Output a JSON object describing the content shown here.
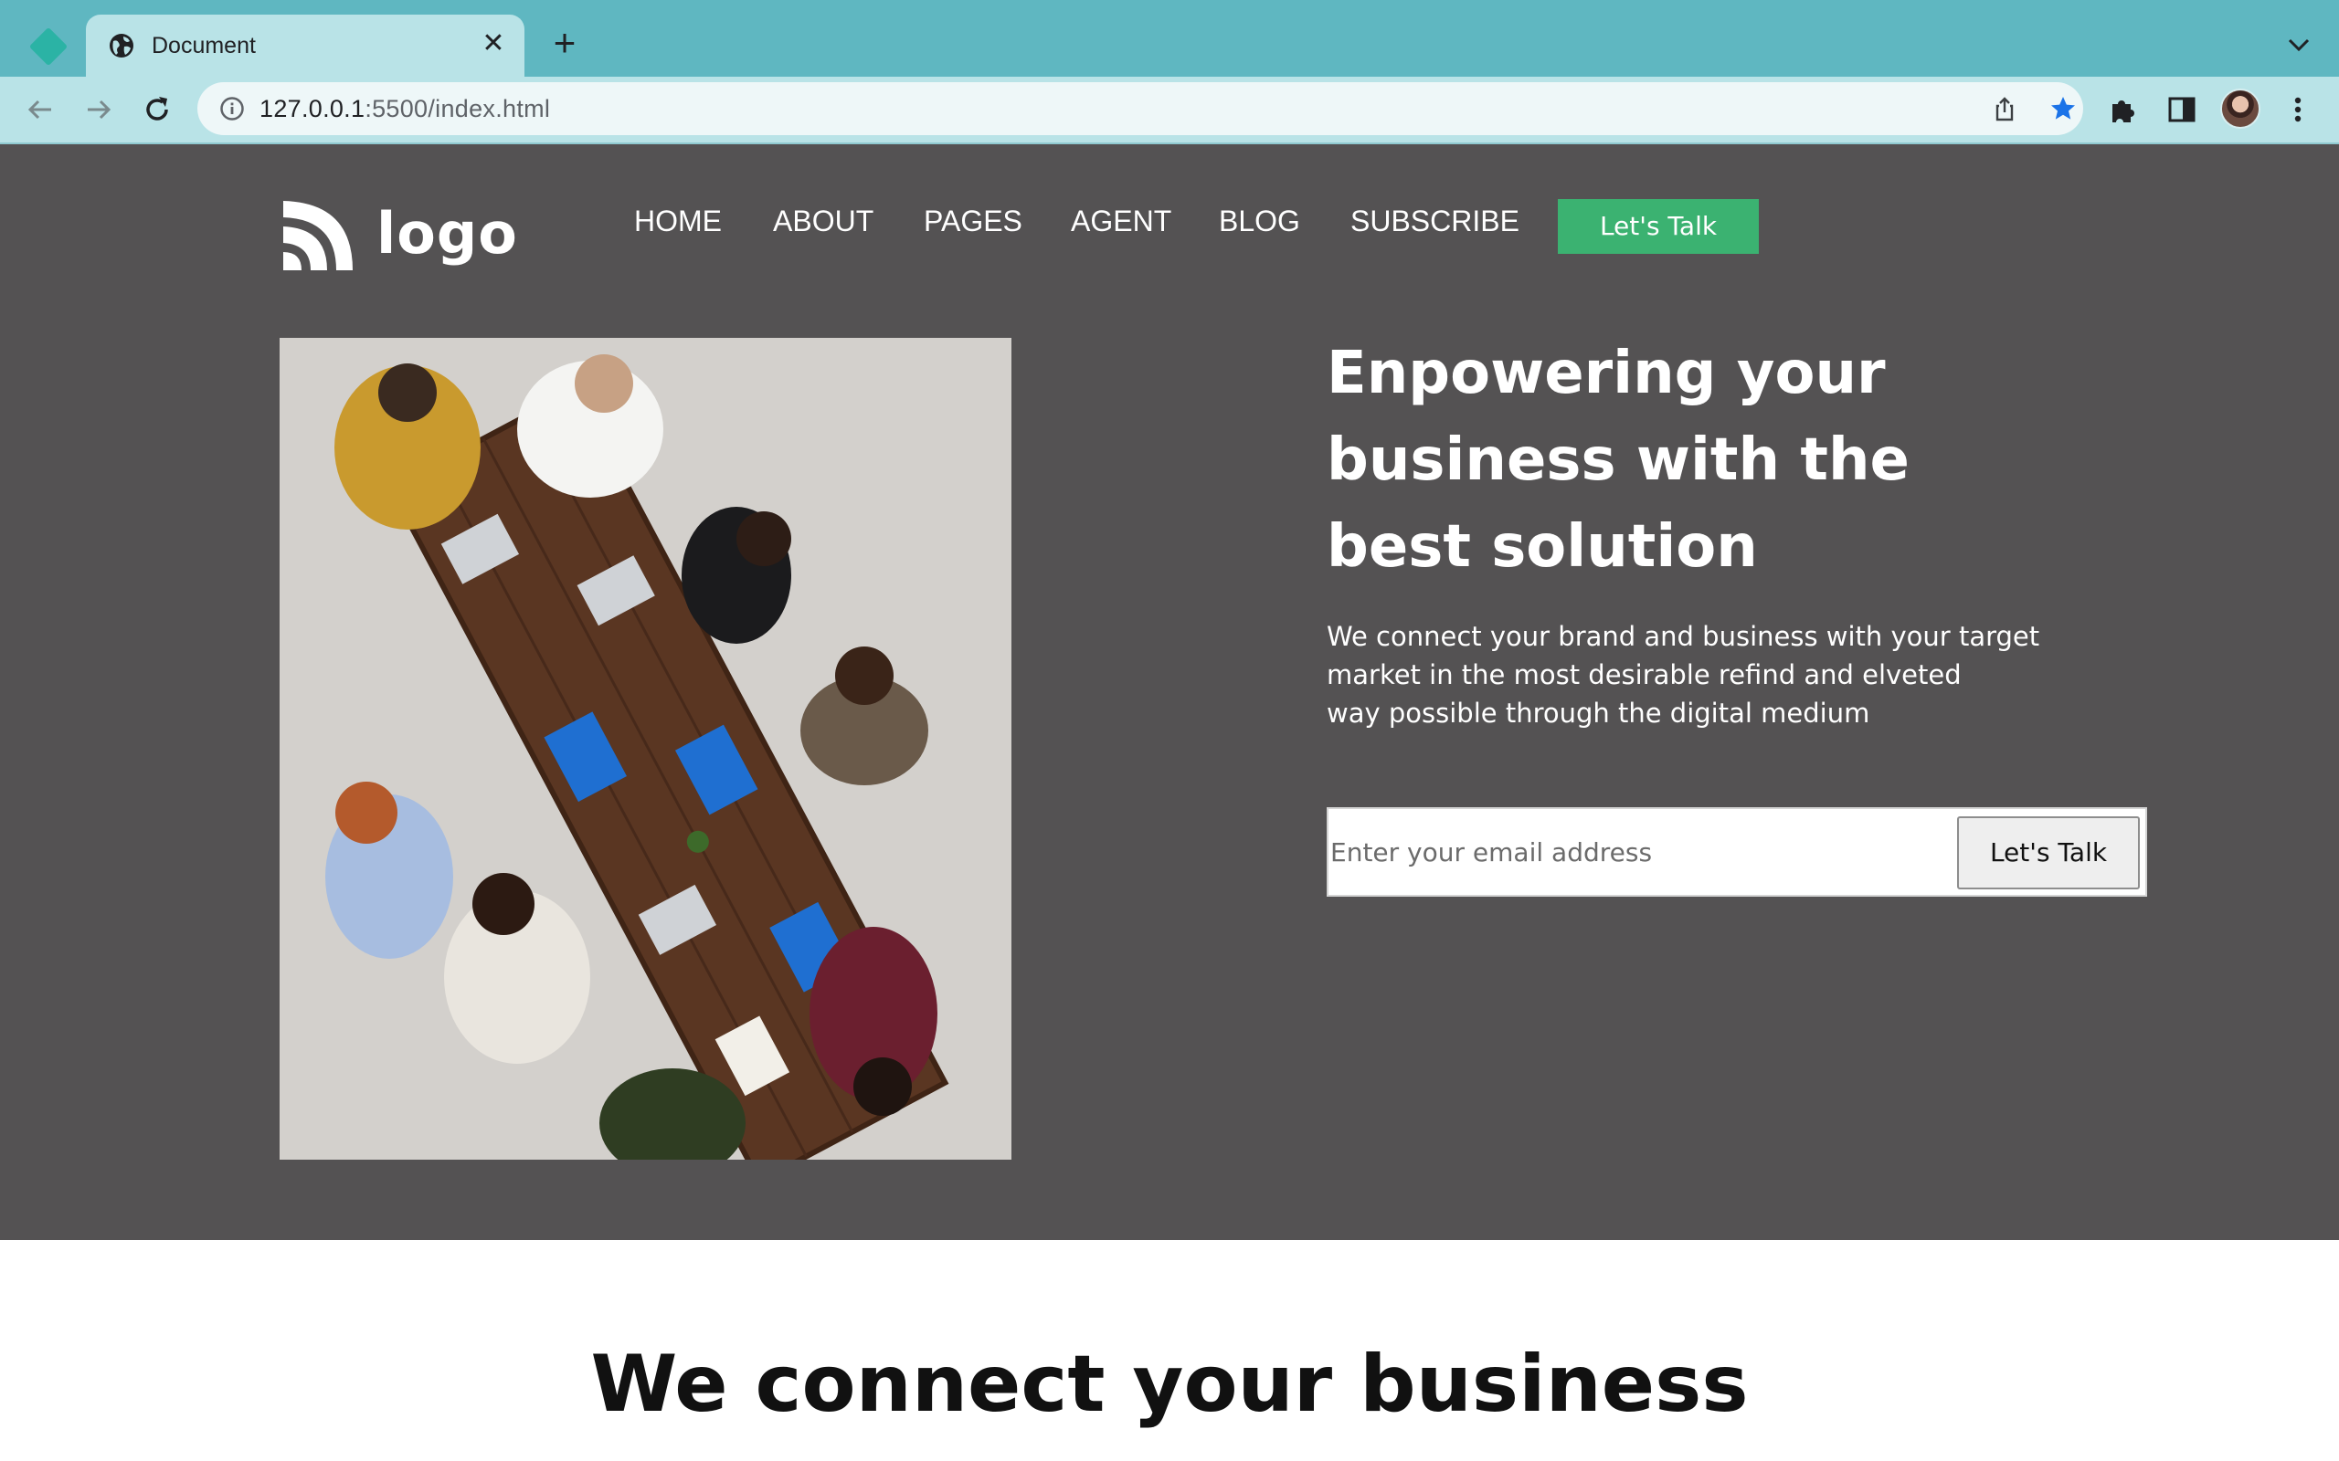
{
  "browser": {
    "tab_title": "Document",
    "url_host": "127.0.0.1",
    "url_rest": ":5500/index.html"
  },
  "site": {
    "logo_text": "logo",
    "nav": [
      "HOME",
      "ABOUT",
      "PAGES",
      "AGENT",
      "BLOG",
      "SUBSCRIBE"
    ],
    "nav_cta": "Let's Talk"
  },
  "hero": {
    "headline_lines": [
      "Enpowering your",
      "business with the",
      "best solution"
    ],
    "sub_lines": [
      "We connect your brand and business with your target",
      "market in the most desirable refind and elveted",
      "way possible through the digital medium"
    ],
    "email_placeholder": "Enter your email address",
    "form_button": "Let's Talk"
  },
  "section": {
    "title": "We connect your business"
  },
  "colors": {
    "tabbar": "#5fb7c1",
    "toolbar": "#b9e3e7",
    "hero_bg": "#545253",
    "cta_green": "#3bb271"
  }
}
